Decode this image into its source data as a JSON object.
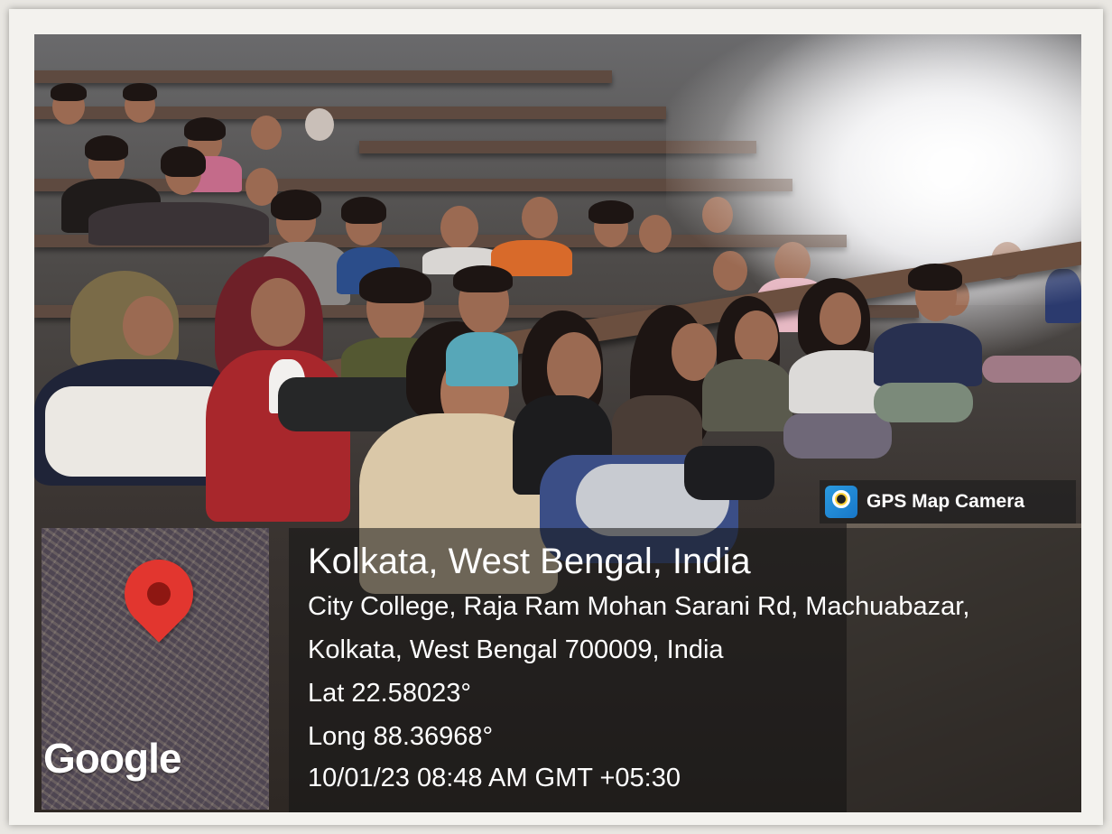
{
  "badge": {
    "label": "GPS Map Camera",
    "icon": "gps-map-camera-icon"
  },
  "map": {
    "watermark": "Google",
    "pin_icon": "map-pin-icon",
    "pin_color": "#e2362f"
  },
  "location": {
    "title": "Kolkata, West Bengal, India",
    "address_line1": "City College, Raja Ram Mohan Sarani Rd, Machuabazar,",
    "address_line2": "Kolkata, West Bengal 700009, India",
    "lat": "Lat 22.58023°",
    "long": "Long 88.36968°",
    "datetime": "10/01/23 08:48 AM GMT +05:30"
  }
}
